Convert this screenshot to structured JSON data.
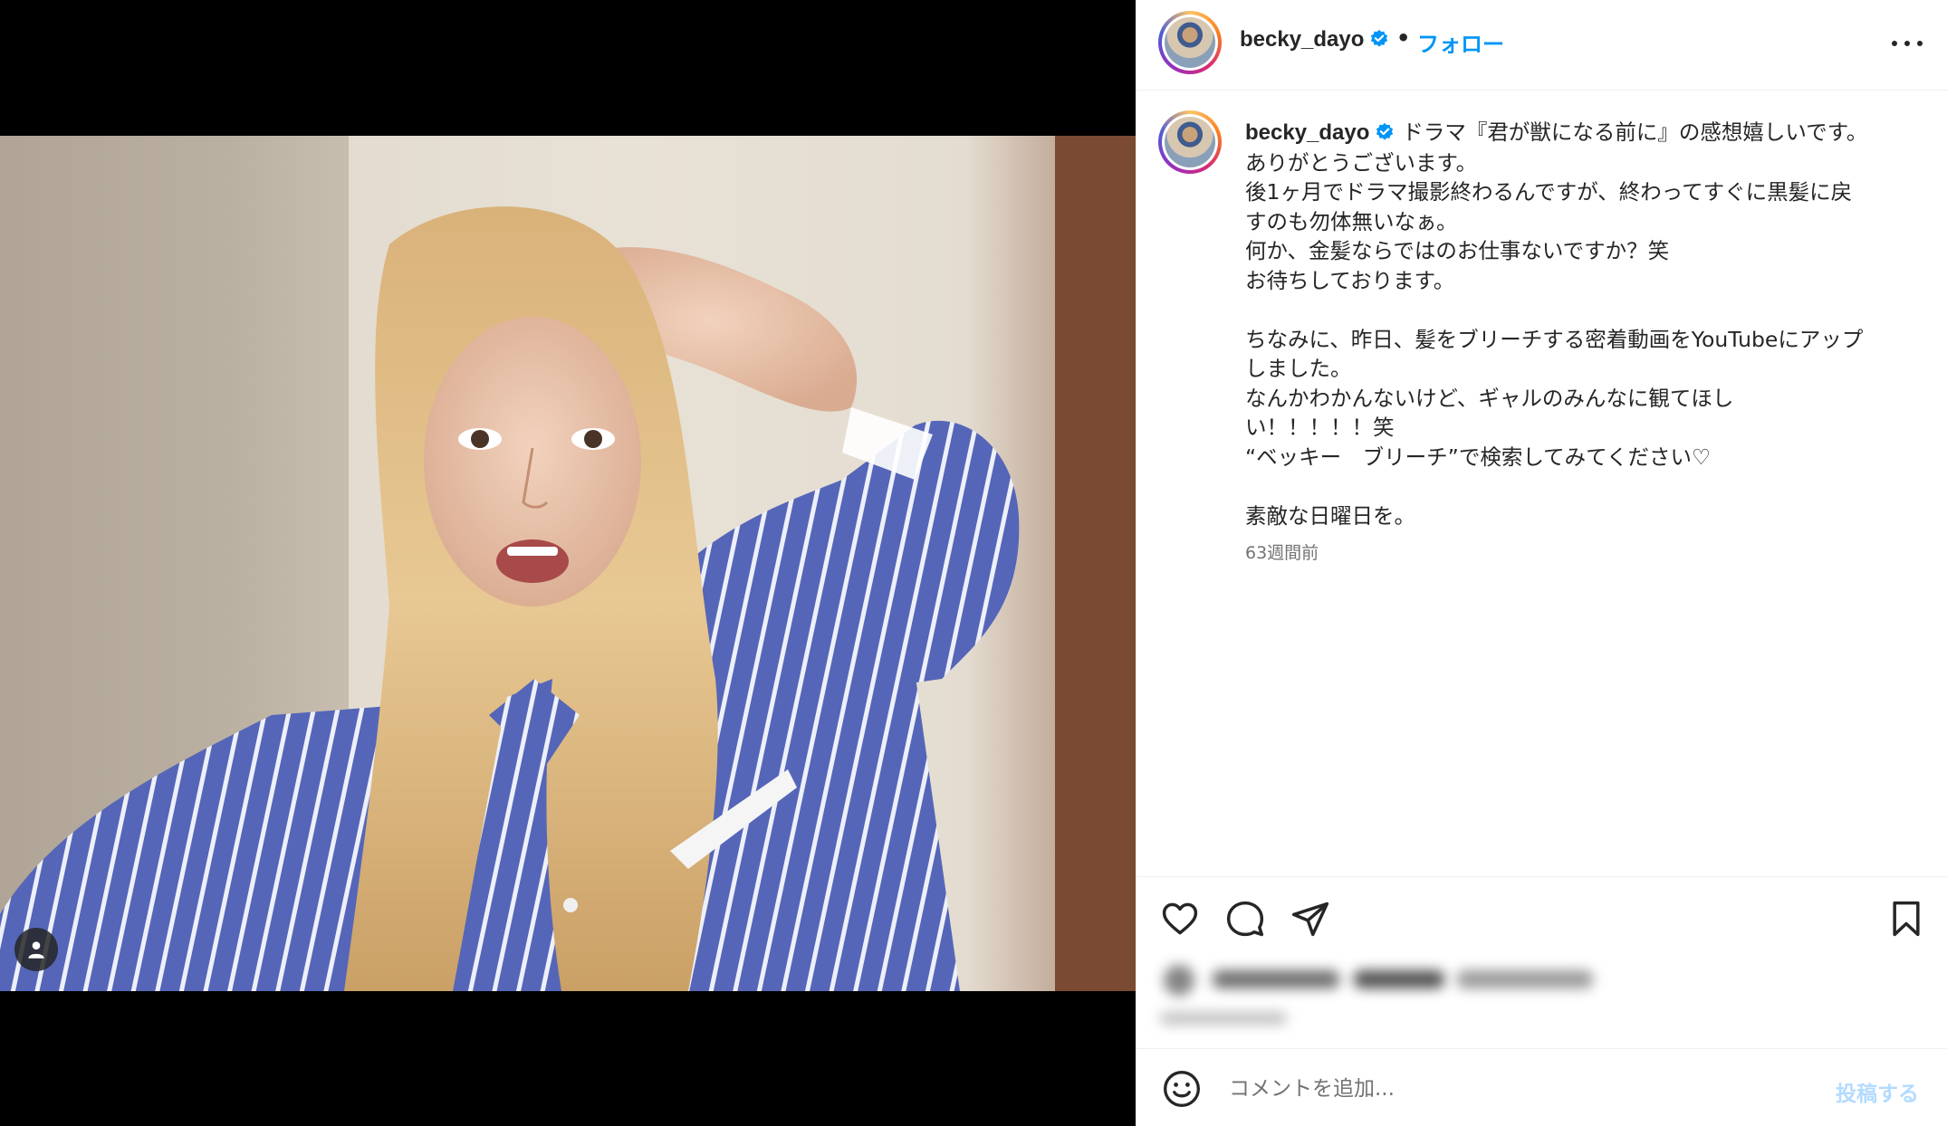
{
  "post": {
    "username": "becky_dayo",
    "separator": "•",
    "follow_label": "フォロー",
    "verified": true,
    "caption": "ドラマ『君が獣になる前に』の感想嬉しいです。\nありがとうございます。\n後1ヶ月でドラマ撮影終わるんですが、終わってすぐに黒髪に戻\nすのも勿体無いなぁ。\n何か、金髪ならではのお仕事ないですか？笑\nお待ちしております。\n\nちなみに、昨日、髪をブリーチする密着動画をYouTubeにアップ\nしました。\nなんかわかんないけど、ギャルのみんなに観てほし\nい！！！！！笑\n“ベッキー　ブリーチ”で検索してみてください♡\n\n素敵な日曜日を。",
    "time_ago": "63週間前"
  },
  "comment": {
    "placeholder": "コメントを追加...",
    "post_label": "投稿する"
  },
  "icons": {
    "more": "more-options-icon",
    "like": "heart-icon",
    "comment": "comment-bubble-icon",
    "share": "paper-plane-icon",
    "save": "bookmark-icon",
    "emoji": "smiley-icon",
    "tag": "user-tag-icon",
    "verified": "verified-badge-icon"
  },
  "colors": {
    "accent": "#0095f6",
    "verified": "#0095f6",
    "post_disabled": "#b3dbff",
    "text": "#262626",
    "muted": "#737373"
  }
}
